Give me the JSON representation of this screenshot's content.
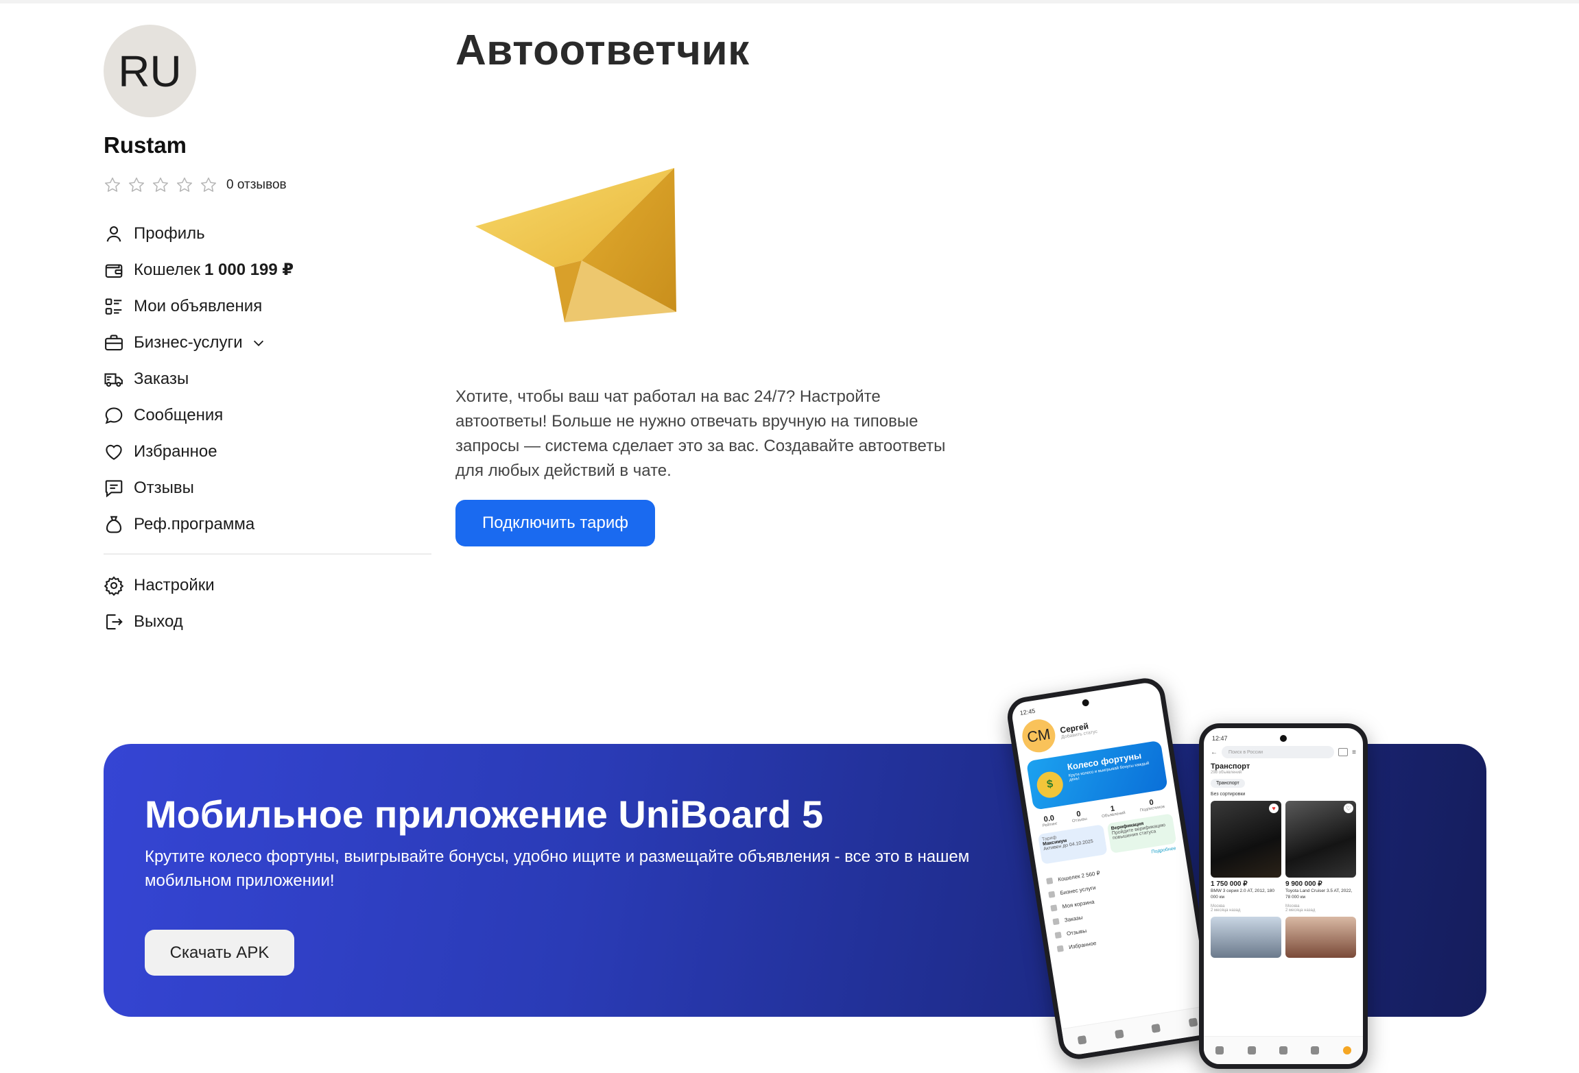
{
  "user": {
    "initials": "RU",
    "name": "Rustam",
    "rating_stars": 0,
    "reviews_text": "0 отзывов"
  },
  "menu": {
    "profile": "Профиль",
    "wallet": "Кошелек",
    "wallet_amount": "1 000 199 ₽",
    "my_ads": "Мои объявления",
    "business": "Бизнес-услуги",
    "orders": "Заказы",
    "messages": "Сообщения",
    "favorites": "Избранное",
    "reviews": "Отзывы",
    "referral": "Реф.программа",
    "settings": "Настройки",
    "logout": "Выход"
  },
  "main": {
    "title": "Автоответчик",
    "description": "Хотите, чтобы ваш чат работал на вас 24/7? Настройте автоответы! Больше не нужно отвечать вручную на типовые запросы — система сделает это за вас. Создавайте автоответы для любых действий в чате.",
    "cta": "Подключить тариф"
  },
  "banner": {
    "title": "Мобильное приложение UniBoard 5",
    "text": "Крутите колесо фортуны, выигрывайте бонусы, удобно ищите и размещайте объявления - все это в нашем мобильном приложении!",
    "button": "Скачать APK"
  },
  "phone1": {
    "time": "12:45",
    "initials": "СМ",
    "name": "Сергей",
    "status": "Добавить статус",
    "wheel_title": "Колесо фортуны",
    "wheel_sub": "Крути колесо и выигрывай бонусы каждый день!",
    "stats": [
      {
        "value": "0.0",
        "label": "Рейтинг"
      },
      {
        "value": "0",
        "label": "Отзывы"
      },
      {
        "value": "1",
        "label": "Объявлений"
      },
      {
        "value": "0",
        "label": "Подписчиков"
      }
    ],
    "tariff_label": "Тариф",
    "tariff_name": "Максимум",
    "tariff_until": "Активен до 04.10.2025",
    "verify_title": "Верификация",
    "verify_text": "Пройдите верификацию повышения статуса",
    "more": "Подробнее",
    "list": [
      "Кошелек 2 560 ₽",
      "Бизнес услуги",
      "Моя корзина",
      "Заказы",
      "Отзывы",
      "Избранное"
    ]
  },
  "phone2": {
    "time": "12:47",
    "search_placeholder": "Поиск в России",
    "category": "Транспорт",
    "count": "298 объявлений",
    "chip": "Транспорт",
    "sort": "Без сортировки",
    "items": [
      {
        "price": "1 750 000 ₽",
        "title": "BMW 3 серия 2.0 AT, 2012, 180 000 км",
        "city": "Москва",
        "ago": "2 месяца назад"
      },
      {
        "price": "9 900 000 ₽",
        "title": "Toyota Land Cruiser 3.5 AT, 2022, 78 000 км",
        "city": "Москва",
        "ago": "2 месяца назад"
      }
    ]
  },
  "colors": {
    "primary": "#1a6af0",
    "banner_start": "#3545d4",
    "banner_end": "#151d5c",
    "plane": "#f2c84b"
  }
}
